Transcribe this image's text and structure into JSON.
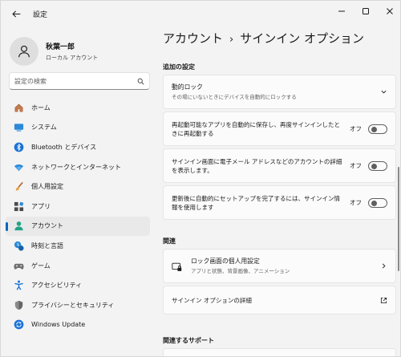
{
  "window": {
    "app_title": "設定"
  },
  "profile": {
    "name": "秋葉一郎",
    "account_type": "ローカル アカウント"
  },
  "search": {
    "placeholder": "設定の検索"
  },
  "nav": {
    "items": [
      {
        "label": "ホーム",
        "icon": "home-icon"
      },
      {
        "label": "システム",
        "icon": "system-icon"
      },
      {
        "label": "Bluetooth とデバイス",
        "icon": "bluetooth-icon"
      },
      {
        "label": "ネットワークとインターネット",
        "icon": "network-icon"
      },
      {
        "label": "個人用設定",
        "icon": "brush-icon"
      },
      {
        "label": "アプリ",
        "icon": "apps-icon"
      },
      {
        "label": "アカウント",
        "icon": "account-icon",
        "active": true
      },
      {
        "label": "時刻と言語",
        "icon": "time-language-icon"
      },
      {
        "label": "ゲーム",
        "icon": "gaming-icon"
      },
      {
        "label": "アクセシビリティ",
        "icon": "accessibility-icon"
      },
      {
        "label": "プライバシーとセキュリティ",
        "icon": "shield-icon"
      },
      {
        "label": "Windows Update",
        "icon": "update-icon"
      }
    ]
  },
  "breadcrumb": {
    "parent": "アカウント",
    "separator": "›",
    "current": "サインイン オプション"
  },
  "additional": {
    "header": "追加の設定",
    "dynamic_lock": {
      "title": "動的ロック",
      "subtitle": "その場にいないときにデバイスを自動的にロックする"
    },
    "settings": [
      {
        "text": "再起動可能なアプリを自動的に保存し、再度サインインしたときに再起動する",
        "state": "オフ"
      },
      {
        "text": "サインイン画面に電子メール アドレスなどのアカウントの詳細を表示します。",
        "state": "オフ"
      },
      {
        "text": "更新後に自動的にセットアップを完了するには、サインイン情報を使用します",
        "state": "オフ"
      }
    ]
  },
  "related": {
    "header": "関連",
    "lock_screen": {
      "title": "ロック画面の個人用設定",
      "subtitle": "アプリと状態、背景画像、アニメーション"
    },
    "signin_details": "サインイン オプションの詳細"
  },
  "support": {
    "header": "関連するサポート"
  },
  "colors": {
    "accent": "#0067c0",
    "background": "#f3f3f3",
    "card": "#fbfbfb"
  }
}
